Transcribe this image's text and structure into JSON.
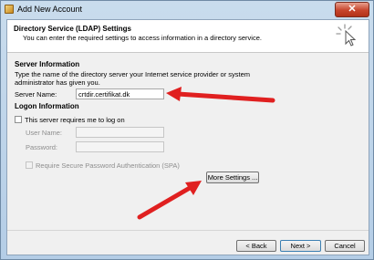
{
  "window": {
    "title": "Add New Account",
    "close_symbol": "✕"
  },
  "header": {
    "title": "Directory Service (LDAP) Settings",
    "subtitle": "You can enter the required settings to access information in a directory service."
  },
  "server_information": {
    "heading": "Server Information",
    "description": "Type the name of the directory server your Internet service provider or system administrator has given you.",
    "server_name_label": "Server Name:",
    "server_name_value": "crtdir.certifikat.dk"
  },
  "logon_information": {
    "heading": "Logon Information",
    "requires_logon_label": "This server requires me to log on",
    "requires_logon_checked": false,
    "user_name_label": "User Name:",
    "user_name_value": "",
    "password_label": "Password:",
    "password_value": "",
    "spa_label": "Require Secure Password Authentication (SPA)",
    "spa_checked": false
  },
  "buttons": {
    "more_settings": "More Settings ...",
    "back": "< Back",
    "next": "Next >",
    "cancel": "Cancel"
  },
  "annotation_color": "#e02020",
  "icons": [
    "title-envelope-icon",
    "close-icon",
    "wizard-cursor-icon",
    "red-arrow-icon"
  ]
}
